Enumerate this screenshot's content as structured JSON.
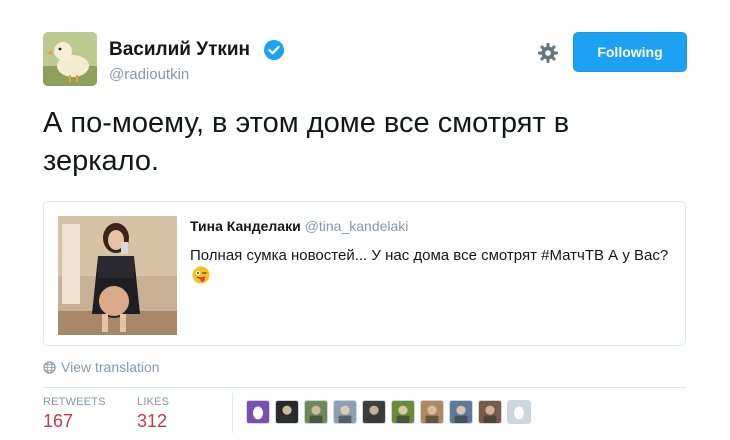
{
  "author": {
    "name": "Василий Уткин",
    "handle": "@radioutkin",
    "verified": true,
    "avatar": "duck-avatar"
  },
  "actions": {
    "follow_label": "Following",
    "settings_icon": "gear-icon"
  },
  "tweet": {
    "text": "А по-моему, в этом доме все смотрят в зеркало."
  },
  "quote": {
    "name": "Тина Канделаки",
    "handle": "@tina_kandelaki",
    "text": "Полная сумка новостей... У нас дома все смотрят #МатчТВ А у Вас?",
    "emoji": "winking-face-with-tongue",
    "photo": "mirror-selfie-photo"
  },
  "translation": {
    "label": "View translation",
    "icon": "globe-icon"
  },
  "stats": {
    "retweets_label": "RETWEETS",
    "retweets_value": "167",
    "likes_label": "LIKES",
    "likes_value": "312"
  },
  "likers": [
    {
      "kind": "egg",
      "color": "#7b4fb1"
    },
    {
      "kind": "dark",
      "color": "#2a2a2a"
    },
    {
      "kind": "photo",
      "color": "#6d8a56"
    },
    {
      "kind": "photo",
      "color": "#8fa0b5"
    },
    {
      "kind": "photo",
      "color": "#3d3d3d"
    },
    {
      "kind": "photo",
      "color": "#6a8c3a"
    },
    {
      "kind": "photo",
      "color": "#b08a5a"
    },
    {
      "kind": "photo",
      "color": "#5d7a9a"
    },
    {
      "kind": "photo",
      "color": "#7a5a4a"
    },
    {
      "kind": "egg",
      "color": "#ccd6dd"
    }
  ],
  "colors": {
    "accent": "#1da1f2",
    "stat_value": "#c23b4a",
    "muted": "#8899a6"
  }
}
